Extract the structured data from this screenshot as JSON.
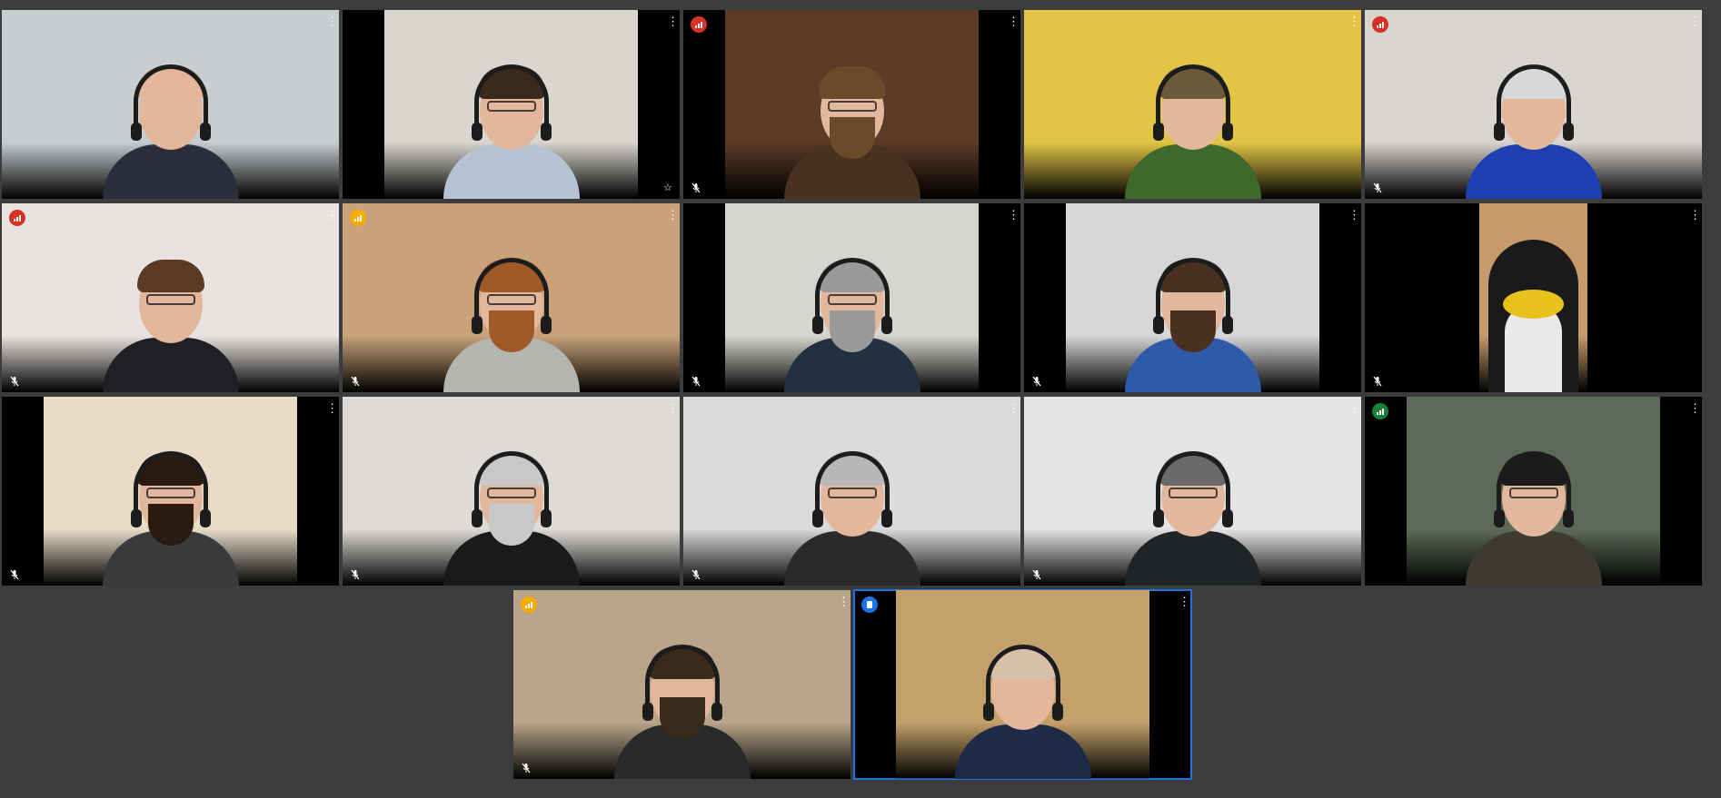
{
  "app": {
    "accent": "#1a73e8",
    "background": "#3c3c3c"
  },
  "icons": {
    "more": "more-vert-icon",
    "signal": "signal-bars-icon",
    "mic_off": "mic-off-icon",
    "pin": "pin-star-icon",
    "speaking": "active-speaker-icon"
  },
  "status_colors": {
    "poor": "#d93025",
    "fair": "#f9ab00",
    "good": "#188038"
  },
  "participants": [
    {
      "wall": "#c8cdd0",
      "shirt": "#2b2e3a",
      "hair": "#e3b59a",
      "beard": false,
      "glasses": false,
      "headset": true,
      "signal": null,
      "muted": false,
      "pin": false,
      "speaking": false
    },
    {
      "wall": "#d9d6cf",
      "shirt": "#b7c3d3",
      "hair": "#3a2a1c",
      "beard": false,
      "glasses": true,
      "headset": true,
      "signal": null,
      "muted": false,
      "pin": true,
      "speaking": false
    },
    {
      "wall": "#5b3a28",
      "shirt": "#4a3020",
      "hair": "#6b4a2a",
      "beard": true,
      "glasses": true,
      "headset": false,
      "signal": "poor",
      "muted": true,
      "pin": false,
      "speaking": false
    },
    {
      "wall": "#e2c545",
      "shirt": "#3d6a2c",
      "hair": "#6b5a3a",
      "beard": false,
      "glasses": false,
      "headset": true,
      "signal": null,
      "muted": false,
      "pin": false,
      "speaking": false
    },
    {
      "wall": "#d8d4d0",
      "shirt": "#1f3fb0",
      "hair": "#d8d8d8",
      "beard": false,
      "glasses": false,
      "headset": true,
      "signal": "poor",
      "muted": true,
      "pin": false,
      "speaking": false
    },
    {
      "wall": "#e8e3e0",
      "shirt": "#1f1f24",
      "hair": "#5a3a22",
      "beard": false,
      "glasses": true,
      "headset": false,
      "signal": "poor",
      "muted": true,
      "pin": false,
      "speaking": false
    },
    {
      "wall": "#c9a27a",
      "shirt": "#b4b4b0",
      "hair": "#a05a2a",
      "beard": true,
      "glasses": true,
      "headset": true,
      "signal": "fair",
      "muted": true,
      "pin": false,
      "speaking": false
    },
    {
      "wall": "#d7d5cf",
      "shirt": "#223040",
      "hair": "#9a9a9a",
      "beard": true,
      "glasses": true,
      "headset": true,
      "signal": null,
      "muted": true,
      "pin": false,
      "speaking": false
    },
    {
      "wall": "#d6d7d9",
      "shirt": "#2f5aa8",
      "hair": "#4a3020",
      "beard": true,
      "glasses": false,
      "headset": true,
      "signal": null,
      "muted": true,
      "pin": false,
      "speaking": false
    },
    {
      "wall": "#c79a6c",
      "shirt": "#101010",
      "hair": "#101010",
      "beard": false,
      "glasses": false,
      "headset": false,
      "signal": null,
      "muted": true,
      "pin": false,
      "speaking": false,
      "mascot": true
    },
    {
      "wall": "#e8dcc8",
      "shirt": "#3a3a3c",
      "hair": "#2a1a12",
      "beard": true,
      "glasses": true,
      "headset": true,
      "signal": null,
      "muted": true,
      "pin": false,
      "speaking": false
    },
    {
      "wall": "#dedbd6",
      "shirt": "#1a1a1a",
      "hair": "#c8c8c8",
      "beard": true,
      "glasses": true,
      "headset": true,
      "signal": null,
      "muted": true,
      "pin": false,
      "speaking": false
    },
    {
      "wall": "#d9dadb",
      "shirt": "#2a2a2a",
      "hair": "#b8b8b8",
      "beard": false,
      "glasses": true,
      "headset": true,
      "signal": null,
      "muted": true,
      "pin": false,
      "speaking": false
    },
    {
      "wall": "#e4e4e6",
      "shirt": "#1f2426",
      "hair": "#6a6a6a",
      "beard": false,
      "glasses": true,
      "headset": true,
      "signal": null,
      "muted": true,
      "pin": false,
      "speaking": false
    },
    {
      "wall": "#5d6a5a",
      "shirt": "#3e3a30",
      "hair": "#1a1a1a",
      "beard": false,
      "glasses": true,
      "headset": true,
      "signal": "good",
      "muted": false,
      "pin": false,
      "speaking": false
    },
    {
      "wall": "#b9a58a",
      "shirt": "#2a2a2a",
      "hair": "#3a2a1a",
      "beard": true,
      "glasses": false,
      "headset": true,
      "signal": "fair",
      "muted": true,
      "pin": false,
      "speaking": false
    },
    {
      "wall": "#c4a06a",
      "shirt": "#1e2a48",
      "hair": "#d7bfaa",
      "beard": false,
      "glasses": false,
      "headset": true,
      "signal": null,
      "muted": false,
      "pin": false,
      "speaking": true
    }
  ]
}
